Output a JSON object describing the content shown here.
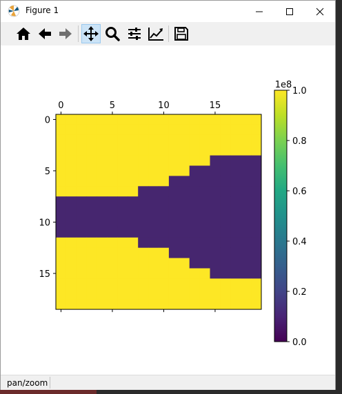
{
  "window": {
    "title": "Figure 1",
    "controls": [
      "minimize",
      "maximize",
      "close"
    ]
  },
  "toolbar": {
    "buttons": [
      {
        "name": "home",
        "icon": "home-icon"
      },
      {
        "name": "back",
        "icon": "arrow-left-icon"
      },
      {
        "name": "forward",
        "icon": "arrow-right-icon"
      },
      {
        "name": "pan",
        "icon": "move-icon",
        "active": true
      },
      {
        "name": "zoom",
        "icon": "magnifier-icon"
      },
      {
        "name": "configure-subplots",
        "icon": "sliders-icon"
      },
      {
        "name": "edit-axis",
        "icon": "line-chart-icon"
      },
      {
        "name": "save",
        "icon": "floppy-icon"
      }
    ]
  },
  "status": {
    "text": "pan/zoom"
  },
  "chart_data": {
    "type": "heatmap",
    "nrows": 19,
    "ncols": 20,
    "x_ticks": [
      "0",
      "5",
      "10",
      "15"
    ],
    "x_tick_values": [
      0,
      5,
      10,
      15
    ],
    "y_ticks": [
      "0",
      "5",
      "10",
      "15"
    ],
    "y_tick_values": [
      0,
      5,
      10,
      15
    ],
    "x_axis_position": "top",
    "grid": false,
    "colormap": "viridis",
    "values_low": 0,
    "values_high": 100000000,
    "low_color": "#46266f",
    "high_color": "#fde725",
    "low_region_by_column": [
      {
        "cols": [
          0,
          7
        ],
        "rows": [
          8,
          11
        ]
      },
      {
        "cols": [
          8,
          10
        ],
        "rows": [
          7,
          12
        ]
      },
      {
        "cols": [
          11,
          12
        ],
        "rows": [
          6,
          13
        ]
      },
      {
        "cols": [
          13,
          14
        ],
        "rows": [
          5,
          14
        ]
      },
      {
        "cols": [
          15,
          19
        ],
        "rows": [
          4,
          15
        ]
      }
    ],
    "colorbar": {
      "ticks": [
        "0.0",
        "0.2",
        "0.4",
        "0.6",
        "0.8",
        "1.0"
      ],
      "tick_values": [
        0.0,
        0.2,
        0.4,
        0.6,
        0.8,
        1.0
      ],
      "multiplier": "1e8",
      "range": [
        0,
        1
      ]
    }
  }
}
